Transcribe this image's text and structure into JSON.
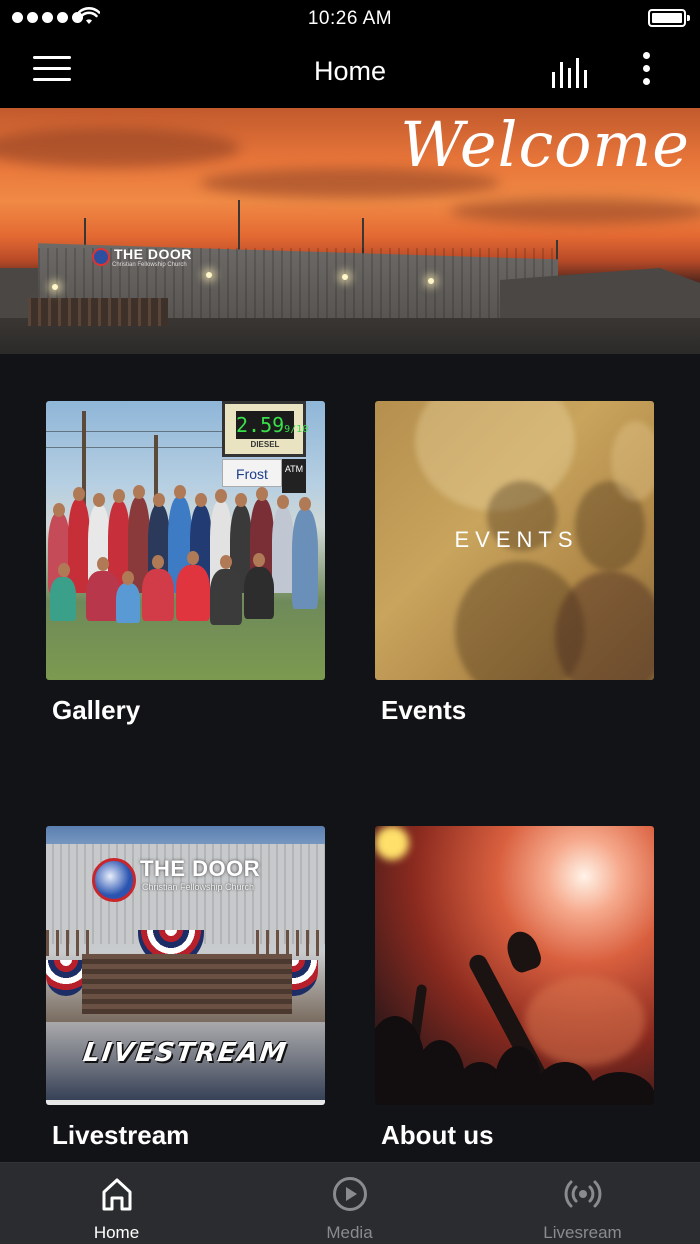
{
  "status_bar": {
    "time": "10:26 AM"
  },
  "navbar": {
    "title": "Home"
  },
  "hero": {
    "welcome_text": "Welcome",
    "sign_text": "THE DOOR",
    "sign_subtext": "Christian Fellowship Church"
  },
  "tiles": [
    {
      "label": "Gallery",
      "price_text": "2.59",
      "price_fraction": "9/10",
      "diesel_text": "DIESEL",
      "frost_text": "Frost",
      "atm_text": "ATM"
    },
    {
      "label": "Events",
      "overlay_text": "EVENTS"
    },
    {
      "label": "Livestream",
      "sign_text": "THE DOOR",
      "sign_subtext": "Christian Fellowship Church",
      "overlay_text": "LIVESTREAM"
    },
    {
      "label": "About us"
    }
  ],
  "tabbar": {
    "tabs": [
      {
        "label": "Home",
        "icon": "home-icon",
        "active": true
      },
      {
        "label": "Media",
        "icon": "play-circle-icon",
        "active": false
      },
      {
        "label": "Livesream",
        "icon": "broadcast-icon",
        "active": false
      }
    ]
  },
  "colors": {
    "background": "#121316",
    "bar": "#000000",
    "tabbar": "#2b2c2f",
    "active_tab": "#ffffff",
    "inactive_tab": "#8a8b8e"
  }
}
